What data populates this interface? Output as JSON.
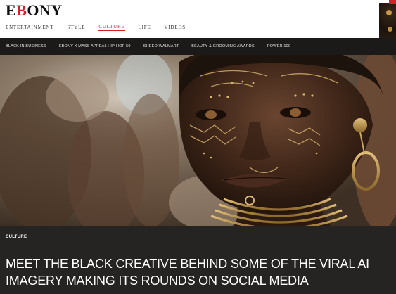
{
  "site": {
    "logo_prefix": "E",
    "logo_accent": "B",
    "logo_suffix": "ONY",
    "brand_color": "#d51f29"
  },
  "main_nav": {
    "items": [
      "ENTERTAINMENT",
      "STYLE",
      "CULTURE",
      "LIFE",
      "VIDEOS"
    ],
    "active": "CULTURE"
  },
  "sub_nav": {
    "items": [
      "BLACK IN BUSINESS",
      "EBONY X MASS APPEAL HIP-HOP 50",
      "SHEEO WALMART",
      "BEAUTY & GROOMING AWARDS",
      "POWER 100"
    ]
  },
  "hero": {
    "alt": "AI-generated portrait of a woman with gold face paint and jewelry"
  },
  "article": {
    "category": "CULTURE",
    "headline": "MEET THE BLACK CREATIVE BEHIND SOME OF THE VIRAL AI IMAGERY MAKING ITS ROUNDS ON SOCIAL MEDIA"
  }
}
